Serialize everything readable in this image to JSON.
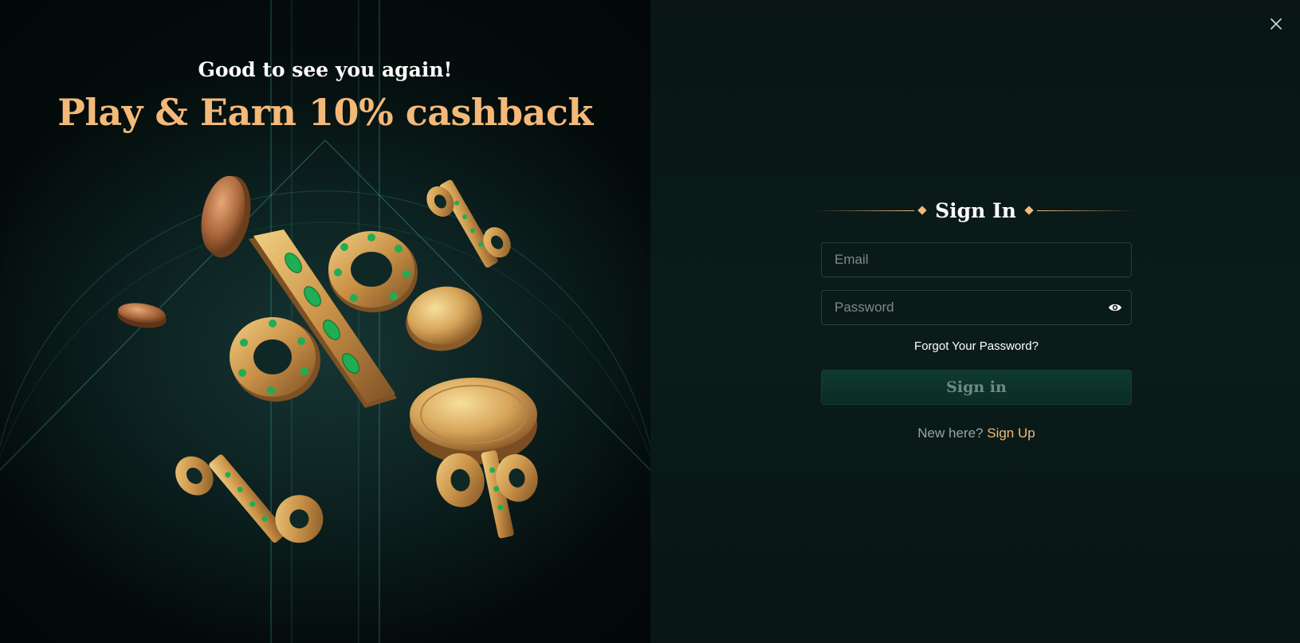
{
  "promo": {
    "subtitle": "Good to see you again!",
    "title": "Play & Earn 10% cashback"
  },
  "form": {
    "close_icon": "close-icon",
    "heading": "Sign In",
    "email": {
      "placeholder": "Email",
      "value": ""
    },
    "password": {
      "placeholder": "Password",
      "value": "",
      "toggle_icon": "eye-icon"
    },
    "forgot_link": "Forgot Your Password?",
    "submit_label": "Sign in",
    "signup_prompt": "New here?",
    "signup_link": "Sign Up"
  },
  "colors": {
    "accent": "#f4b979",
    "panel_bg": "#081513",
    "button_bg": "#0f3a2e",
    "emerald": "#1fae53"
  }
}
